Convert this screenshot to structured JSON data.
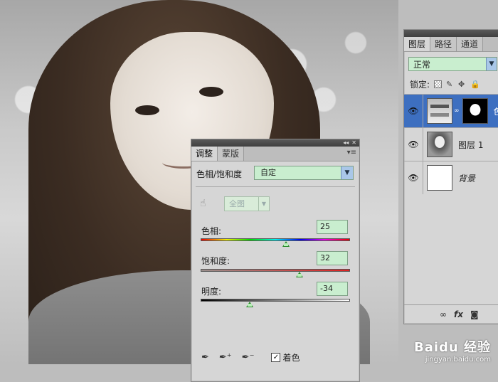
{
  "adjustments_panel": {
    "tabs": [
      "调整",
      "蒙版"
    ],
    "type_label": "色相/饱和度",
    "preset_value": "自定",
    "range_value": "全图",
    "sliders": [
      {
        "label": "色相:",
        "value": "25",
        "min": -180,
        "max": 180
      },
      {
        "label": "饱和度:",
        "value": "32",
        "min": -100,
        "max": 100
      },
      {
        "label": "明度:",
        "value": "-34",
        "min": -100,
        "max": 100
      }
    ],
    "colorize_label": "着色",
    "colorize_checked": true
  },
  "layers_panel": {
    "tabs": [
      "图层",
      "路径",
      "通道"
    ],
    "blend_mode": "正常",
    "lock_label": "锁定:",
    "layers": [
      {
        "name": "色",
        "type": "adjustment",
        "selected": true
      },
      {
        "name": "图层 1",
        "type": "photo",
        "selected": false
      },
      {
        "name": "背景",
        "type": "background",
        "selected": false
      }
    ]
  },
  "watermark": {
    "brand": "Baidu 经验",
    "url": "jingyan.baidu.com"
  },
  "colors": {
    "field_green": "#c9eecf",
    "selection_blue": "#3d6fc0",
    "panel_bg": "#d6d6d6"
  }
}
